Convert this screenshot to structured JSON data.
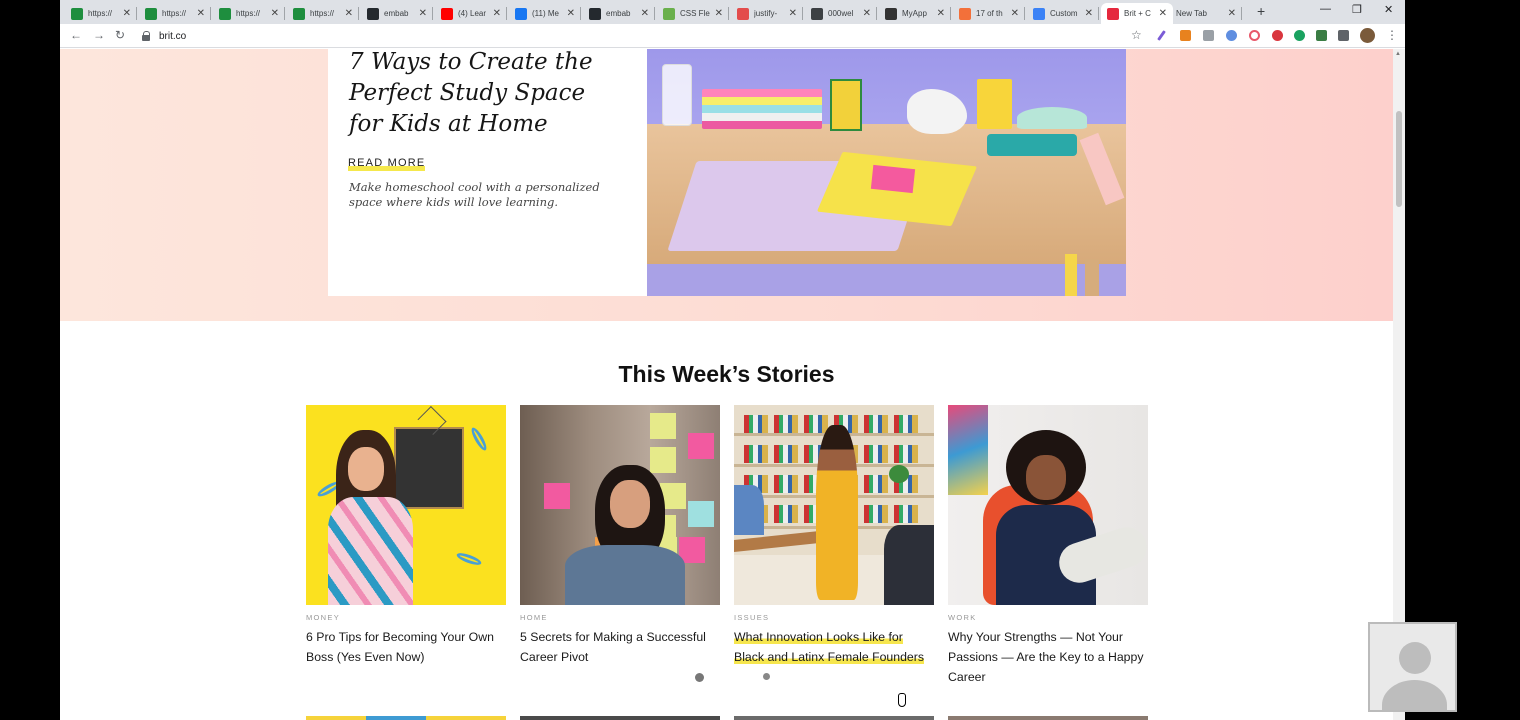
{
  "browser": {
    "tabs": [
      {
        "label": "https://",
        "fav": "sheets-icon",
        "color": "#1e8e3e"
      },
      {
        "label": "https://",
        "fav": "sheets-icon",
        "color": "#1e8e3e"
      },
      {
        "label": "https://",
        "fav": "sheets-icon",
        "color": "#1e8e3e"
      },
      {
        "label": "https://",
        "fav": "sheets-icon",
        "color": "#1e8e3e"
      },
      {
        "label": "embab",
        "fav": "github-icon",
        "color": "#24292e"
      },
      {
        "label": "(4) Lear",
        "fav": "youtube-icon",
        "color": "#ff0000"
      },
      {
        "label": "(11) Me",
        "fav": "facebook-icon",
        "color": "#1877f2"
      },
      {
        "label": "embab",
        "fav": "github-icon",
        "color": "#24292e"
      },
      {
        "label": "CSS Fle",
        "fav": "css-tricks-icon",
        "color": "#6ab04c"
      },
      {
        "label": "justify-",
        "fav": "asterisk-icon",
        "color": "#e34c4c"
      },
      {
        "label": "000wel",
        "fav": "globe-icon",
        "color": "#3c4043"
      },
      {
        "label": "MyApp",
        "fav": "angular-icon",
        "color": "#333333"
      },
      {
        "label": "17 of th",
        "fav": "bookmark-icon",
        "color": "#f3703a"
      },
      {
        "label": "Custom",
        "fav": "bolt-icon",
        "color": "#3b82f6"
      },
      {
        "label": "Brit + C",
        "fav": "brit-icon",
        "color": "#e5283d",
        "active": true
      },
      {
        "label": "New Tab",
        "fav": "",
        "color": ""
      }
    ],
    "new_tab": "+",
    "window_controls": {
      "minimize": "—",
      "restore": "❐",
      "close": "✕"
    },
    "nav": {
      "back": "←",
      "forward": "→",
      "reload": "↻"
    },
    "url": "brit.co",
    "star": "☆",
    "menu": "⋮"
  },
  "hero": {
    "title": "7 Ways to Create the Perfect Study Space for Kids at Home",
    "read_more": "READ MORE",
    "description": "Make homeschool cool with a personalized space where kids will love learning."
  },
  "section_title": "This Week’s Stories",
  "stories": [
    {
      "category": "MONEY",
      "headline": "6 Pro Tips for Becoming Your Own Boss (Yes Even Now)",
      "highlighted": false
    },
    {
      "category": "HOME",
      "headline": "5 Secrets for Making a Successful Career Pivot",
      "highlighted": false
    },
    {
      "category": "ISSUES",
      "headline": "What Innovation Looks Like for Black and Latinx Female Founders",
      "highlighted": true
    },
    {
      "category": "WORK",
      "headline": "Why Your Strengths — Not Your Passions — Are the Key to a Happy Career",
      "highlighted": false
    }
  ],
  "colors": {
    "highlight": "#f6e64e",
    "hero_bg": "#fddbd3"
  }
}
